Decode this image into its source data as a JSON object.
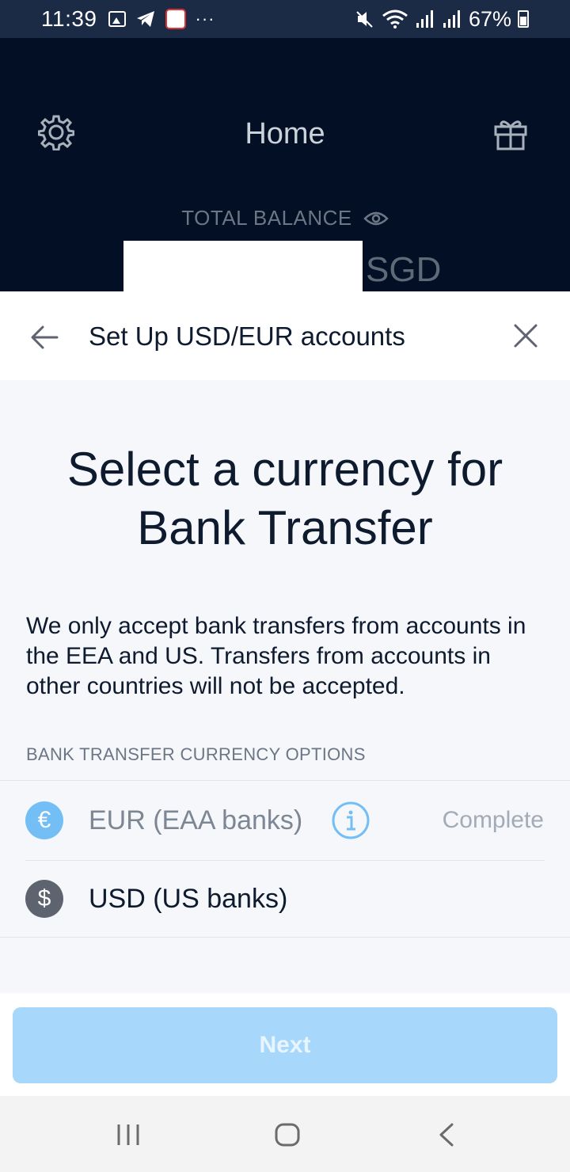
{
  "status_bar": {
    "time": "11:39",
    "battery": "67%",
    "icons": [
      "gallery-icon",
      "telegram-icon",
      "app-notification-icon",
      "more-dots-icon",
      "mute-icon",
      "wifi-icon",
      "signal-icon",
      "signal-icon",
      "battery-icon"
    ]
  },
  "home": {
    "title": "Home",
    "balance_label": "TOTAL BALANCE",
    "currency": "SGD",
    "icons": [
      "settings-icon",
      "gift-icon",
      "eye-icon"
    ]
  },
  "sheet": {
    "title": "Set Up USD/EUR accounts",
    "headline": [
      "Select a currency for",
      "Bank Transfer"
    ],
    "notice": "We only accept bank transfers from accounts in the EEA and US. Transfers from accounts in other countries will not be accepted.",
    "section_label": "BANK TRANSFER CURRENCY OPTIONS",
    "options": [
      {
        "symbol": "€",
        "label": "EUR (EAA banks)",
        "status": "Complete",
        "icon": "euro-icon"
      },
      {
        "symbol": "$",
        "label": "USD (US banks)",
        "status": "",
        "icon": "dollar-icon"
      }
    ],
    "next_label": "Next"
  },
  "colors": {
    "header_bg": "#030f24",
    "accent_disabled": "#a7d8fb",
    "eur_badge": "#73bff5",
    "usd_badge": "#5d6470",
    "info_icon": "#73bff5"
  }
}
